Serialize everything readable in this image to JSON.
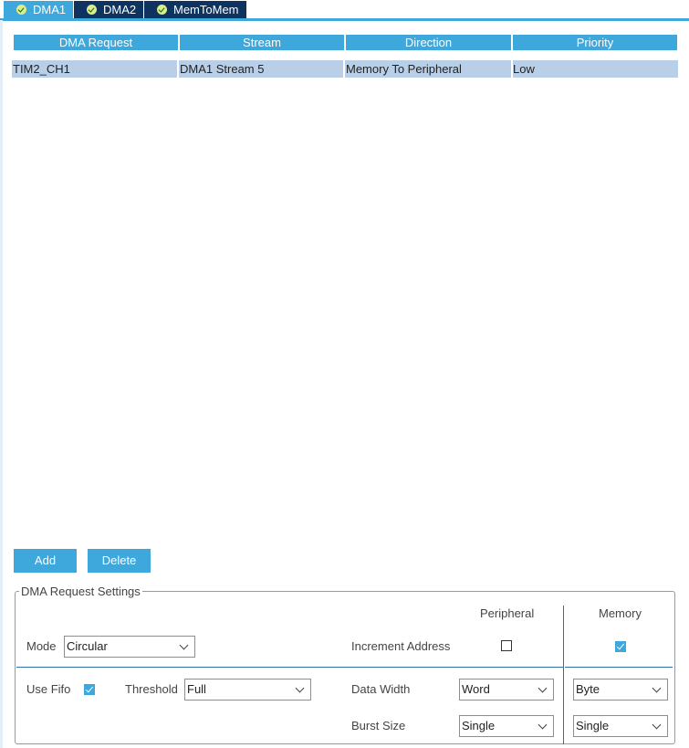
{
  "tabs": [
    {
      "label": "DMA1",
      "active": true
    },
    {
      "label": "DMA2",
      "active": false
    },
    {
      "label": "MemToMem",
      "active": false
    }
  ],
  "table": {
    "columns": [
      "DMA Request",
      "Stream",
      "Direction",
      "Priority"
    ],
    "rows": [
      [
        "TIM2_CH1",
        "DMA1 Stream 5",
        "Memory To Peripheral",
        "Low"
      ]
    ]
  },
  "buttons": {
    "add": "Add",
    "delete": "Delete"
  },
  "settings": {
    "title": "DMA Request Settings",
    "peripheral_header": "Peripheral",
    "memory_header": "Memory",
    "mode_label": "Mode",
    "mode_value": "Circular",
    "increment_label": "Increment Address",
    "peripheral_increment": false,
    "memory_increment": true,
    "use_fifo_label": "Use Fifo",
    "use_fifo": true,
    "threshold_label": "Threshold",
    "threshold_value": "Full",
    "data_width_label": "Data Width",
    "peripheral_data_width": "Word",
    "memory_data_width": "Byte",
    "burst_size_label": "Burst Size",
    "peripheral_burst_size": "Single",
    "memory_burst_size": "Single"
  },
  "colors": {
    "accent": "#3ea7dc",
    "tab_inactive": "#0f3360",
    "row_selected": "#b8cfe7"
  }
}
